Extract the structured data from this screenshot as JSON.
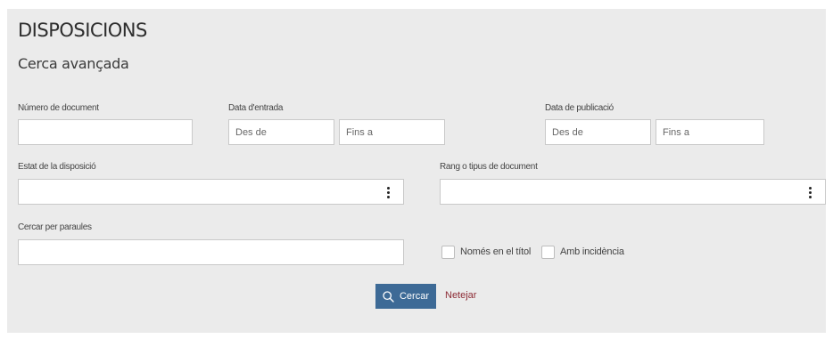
{
  "header": {
    "title": "DISPOSICIONS",
    "subtitle": "Cerca avançada"
  },
  "fields": {
    "document_number": {
      "label": "Número de document",
      "value": ""
    },
    "entry_date": {
      "label": "Data d'entrada",
      "from_placeholder": "Des de",
      "to_placeholder": "Fins a"
    },
    "publication_date": {
      "label": "Data de publicació",
      "from_placeholder": "Des de",
      "to_placeholder": "Fins a"
    },
    "status": {
      "label": "Estat de la disposició",
      "selected": ""
    },
    "rank_type": {
      "label": "Rang o tipus de document",
      "selected": ""
    },
    "keywords": {
      "label": "Cercar per paraules",
      "value": ""
    }
  },
  "options": {
    "title_only": {
      "label": "Només en el títol",
      "checked": false
    },
    "with_incidence": {
      "label": "Amb incidència",
      "checked": false
    }
  },
  "actions": {
    "search_label": "Cercar",
    "clear_label": "Netejar"
  },
  "colors": {
    "panel_bg": "#ebebeb",
    "primary_button": "#3d6a96",
    "clear_link": "#8d2b35"
  }
}
